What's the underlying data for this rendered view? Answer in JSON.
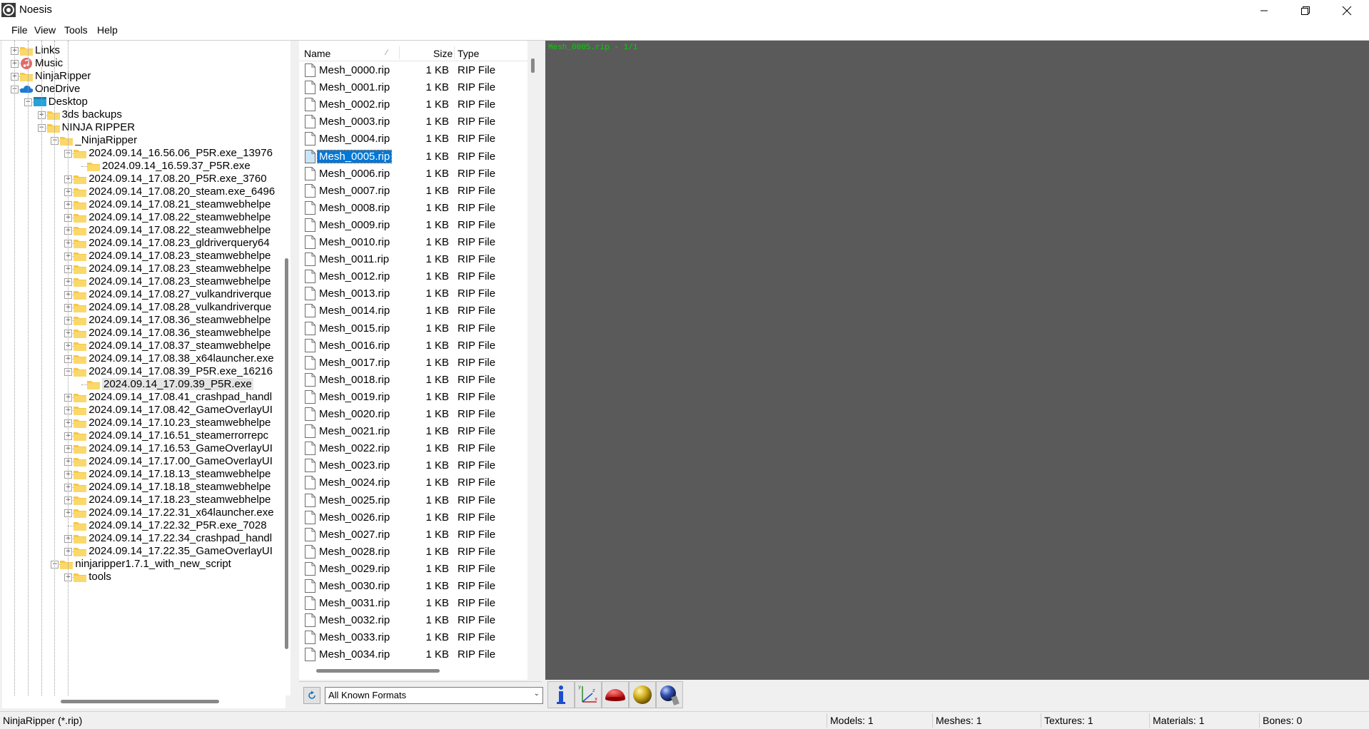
{
  "window": {
    "title": "Noesis"
  },
  "menu": [
    "File",
    "View",
    "Tools",
    "Help"
  ],
  "tree": [
    {
      "label": "Links",
      "level": 1,
      "expander": "+",
      "icon": "folder-icon"
    },
    {
      "label": "Music",
      "level": 1,
      "expander": "+",
      "icon": "music-icon"
    },
    {
      "label": "NinjaRipper",
      "level": 1,
      "expander": "+",
      "icon": "folder-icon"
    },
    {
      "label": "OneDrive",
      "level": 1,
      "expander": "-",
      "icon": "cloud-icon"
    },
    {
      "label": "Desktop",
      "level": 2,
      "expander": "-",
      "icon": "desktop-icon"
    },
    {
      "label": "3ds backups",
      "level": 3,
      "expander": "+",
      "icon": "folder-icon"
    },
    {
      "label": "NINJA RIPPER",
      "level": 3,
      "expander": "-",
      "icon": "folder-icon"
    },
    {
      "label": "_NinjaRipper",
      "level": 4,
      "expander": "-",
      "icon": "folder-icon"
    },
    {
      "label": "2024.09.14_16.56.06_P5R.exe_13976",
      "level": 5,
      "expander": "-",
      "icon": "folder-icon"
    },
    {
      "label": "2024.09.14_16.59.37_P5R.exe",
      "level": 6,
      "expander": "",
      "icon": "folder-icon"
    },
    {
      "label": "2024.09.14_17.08.20_P5R.exe_3760",
      "level": 5,
      "expander": "+",
      "icon": "folder-icon"
    },
    {
      "label": "2024.09.14_17.08.20_steam.exe_6496",
      "level": 5,
      "expander": "+",
      "icon": "folder-icon"
    },
    {
      "label": "2024.09.14_17.08.21_steamwebhelpe",
      "level": 5,
      "expander": "+",
      "icon": "folder-icon"
    },
    {
      "label": "2024.09.14_17.08.22_steamwebhelpe",
      "level": 5,
      "expander": "+",
      "icon": "folder-icon"
    },
    {
      "label": "2024.09.14_17.08.22_steamwebhelpe",
      "level": 5,
      "expander": "+",
      "icon": "folder-icon"
    },
    {
      "label": "2024.09.14_17.08.23_gldriverquery64",
      "level": 5,
      "expander": "+",
      "icon": "folder-icon"
    },
    {
      "label": "2024.09.14_17.08.23_steamwebhelpe",
      "level": 5,
      "expander": "+",
      "icon": "folder-icon"
    },
    {
      "label": "2024.09.14_17.08.23_steamwebhelpe",
      "level": 5,
      "expander": "+",
      "icon": "folder-icon"
    },
    {
      "label": "2024.09.14_17.08.23_steamwebhelpe",
      "level": 5,
      "expander": "+",
      "icon": "folder-icon"
    },
    {
      "label": "2024.09.14_17.08.27_vulkandriverque",
      "level": 5,
      "expander": "+",
      "icon": "folder-icon"
    },
    {
      "label": "2024.09.14_17.08.28_vulkandriverque",
      "level": 5,
      "expander": "+",
      "icon": "folder-icon"
    },
    {
      "label": "2024.09.14_17.08.36_steamwebhelpe",
      "level": 5,
      "expander": "+",
      "icon": "folder-icon"
    },
    {
      "label": "2024.09.14_17.08.36_steamwebhelpe",
      "level": 5,
      "expander": "+",
      "icon": "folder-icon"
    },
    {
      "label": "2024.09.14_17.08.37_steamwebhelpe",
      "level": 5,
      "expander": "+",
      "icon": "folder-icon"
    },
    {
      "label": "2024.09.14_17.08.38_x64launcher.exe",
      "level": 5,
      "expander": "+",
      "icon": "folder-icon"
    },
    {
      "label": "2024.09.14_17.08.39_P5R.exe_16216",
      "level": 5,
      "expander": "-",
      "icon": "folder-icon"
    },
    {
      "label": "2024.09.14_17.09.39_P5R.exe",
      "level": 6,
      "expander": "",
      "icon": "folder-icon",
      "selected": true
    },
    {
      "label": "2024.09.14_17.08.41_crashpad_handl",
      "level": 5,
      "expander": "+",
      "icon": "folder-icon"
    },
    {
      "label": "2024.09.14_17.08.42_GameOverlayUI",
      "level": 5,
      "expander": "+",
      "icon": "folder-icon"
    },
    {
      "label": "2024.09.14_17.10.23_steamwebhelpe",
      "level": 5,
      "expander": "+",
      "icon": "folder-icon"
    },
    {
      "label": "2024.09.14_17.16.51_steamerrorrepc",
      "level": 5,
      "expander": "+",
      "icon": "folder-icon"
    },
    {
      "label": "2024.09.14_17.16.53_GameOverlayUI",
      "level": 5,
      "expander": "+",
      "icon": "folder-icon"
    },
    {
      "label": "2024.09.14_17.17.00_GameOverlayUI",
      "level": 5,
      "expander": "+",
      "icon": "folder-icon"
    },
    {
      "label": "2024.09.14_17.18.13_steamwebhelpe",
      "level": 5,
      "expander": "+",
      "icon": "folder-icon"
    },
    {
      "label": "2024.09.14_17.18.18_steamwebhelpe",
      "level": 5,
      "expander": "+",
      "icon": "folder-icon"
    },
    {
      "label": "2024.09.14_17.18.23_steamwebhelpe",
      "level": 5,
      "expander": "+",
      "icon": "folder-icon"
    },
    {
      "label": "2024.09.14_17.22.31_x64launcher.exe",
      "level": 5,
      "expander": "+",
      "icon": "folder-icon"
    },
    {
      "label": "2024.09.14_17.22.32_P5R.exe_7028",
      "level": 5,
      "expander": "",
      "icon": "folder-icon"
    },
    {
      "label": "2024.09.14_17.22.34_crashpad_handl",
      "level": 5,
      "expander": "+",
      "icon": "folder-icon"
    },
    {
      "label": "2024.09.14_17.22.35_GameOverlayUI",
      "level": 5,
      "expander": "+",
      "icon": "folder-icon"
    },
    {
      "label": "ninjaripper1.7.1_with_new_script",
      "level": 4,
      "expander": "-",
      "icon": "folder-icon"
    },
    {
      "label": "tools",
      "level": 5,
      "expander": "+",
      "icon": "folder-icon"
    }
  ],
  "file_list": {
    "columns": {
      "name": "Name",
      "size": "Size",
      "type": "Type"
    },
    "rows": [
      {
        "name": "Mesh_0000.rip",
        "size": "1 KB",
        "type": "RIP File"
      },
      {
        "name": "Mesh_0001.rip",
        "size": "1 KB",
        "type": "RIP File"
      },
      {
        "name": "Mesh_0002.rip",
        "size": "1 KB",
        "type": "RIP File"
      },
      {
        "name": "Mesh_0003.rip",
        "size": "1 KB",
        "type": "RIP File"
      },
      {
        "name": "Mesh_0004.rip",
        "size": "1 KB",
        "type": "RIP File"
      },
      {
        "name": "Mesh_0005.rip",
        "size": "1 KB",
        "type": "RIP File",
        "selected": true
      },
      {
        "name": "Mesh_0006.rip",
        "size": "1 KB",
        "type": "RIP File"
      },
      {
        "name": "Mesh_0007.rip",
        "size": "1 KB",
        "type": "RIP File"
      },
      {
        "name": "Mesh_0008.rip",
        "size": "1 KB",
        "type": "RIP File"
      },
      {
        "name": "Mesh_0009.rip",
        "size": "1 KB",
        "type": "RIP File"
      },
      {
        "name": "Mesh_0010.rip",
        "size": "1 KB",
        "type": "RIP File"
      },
      {
        "name": "Mesh_0011.rip",
        "size": "1 KB",
        "type": "RIP File"
      },
      {
        "name": "Mesh_0012.rip",
        "size": "1 KB",
        "type": "RIP File"
      },
      {
        "name": "Mesh_0013.rip",
        "size": "1 KB",
        "type": "RIP File"
      },
      {
        "name": "Mesh_0014.rip",
        "size": "1 KB",
        "type": "RIP File"
      },
      {
        "name": "Mesh_0015.rip",
        "size": "1 KB",
        "type": "RIP File"
      },
      {
        "name": "Mesh_0016.rip",
        "size": "1 KB",
        "type": "RIP File"
      },
      {
        "name": "Mesh_0017.rip",
        "size": "1 KB",
        "type": "RIP File"
      },
      {
        "name": "Mesh_0018.rip",
        "size": "1 KB",
        "type": "RIP File"
      },
      {
        "name": "Mesh_0019.rip",
        "size": "1 KB",
        "type": "RIP File"
      },
      {
        "name": "Mesh_0020.rip",
        "size": "1 KB",
        "type": "RIP File"
      },
      {
        "name": "Mesh_0021.rip",
        "size": "1 KB",
        "type": "RIP File"
      },
      {
        "name": "Mesh_0022.rip",
        "size": "1 KB",
        "type": "RIP File"
      },
      {
        "name": "Mesh_0023.rip",
        "size": "1 KB",
        "type": "RIP File"
      },
      {
        "name": "Mesh_0024.rip",
        "size": "1 KB",
        "type": "RIP File"
      },
      {
        "name": "Mesh_0025.rip",
        "size": "1 KB",
        "type": "RIP File"
      },
      {
        "name": "Mesh_0026.rip",
        "size": "1 KB",
        "type": "RIP File"
      },
      {
        "name": "Mesh_0027.rip",
        "size": "1 KB",
        "type": "RIP File"
      },
      {
        "name": "Mesh_0028.rip",
        "size": "1 KB",
        "type": "RIP File"
      },
      {
        "name": "Mesh_0029.rip",
        "size": "1 KB",
        "type": "RIP File"
      },
      {
        "name": "Mesh_0030.rip",
        "size": "1 KB",
        "type": "RIP File"
      },
      {
        "name": "Mesh_0031.rip",
        "size": "1 KB",
        "type": "RIP File"
      },
      {
        "name": "Mesh_0032.rip",
        "size": "1 KB",
        "type": "RIP File"
      },
      {
        "name": "Mesh_0033.rip",
        "size": "1 KB",
        "type": "RIP File"
      },
      {
        "name": "Mesh_0034.rip",
        "size": "1 KB",
        "type": "RIP File"
      }
    ]
  },
  "format_filter": {
    "selected": "All Known Formats"
  },
  "viewport": {
    "label": "Mesh_0005.rip - 1/1",
    "background": "#5a5a5a",
    "label_color": "#00d200"
  },
  "toolbar": [
    {
      "icon": "info-icon"
    },
    {
      "icon": "axes-icon"
    },
    {
      "icon": "red-dome-icon"
    },
    {
      "icon": "gold-sphere-icon"
    },
    {
      "icon": "blue-sphere-icon"
    }
  ],
  "statusbar": {
    "format": "NinjaRipper (*.rip)",
    "models": "Models: 1",
    "meshes": "Meshes: 1",
    "textures": "Textures: 1",
    "materials": "Materials: 1",
    "bones": "Bones: 0"
  },
  "colors": {
    "selection": "#0078d7",
    "folder": "#f7c843"
  }
}
